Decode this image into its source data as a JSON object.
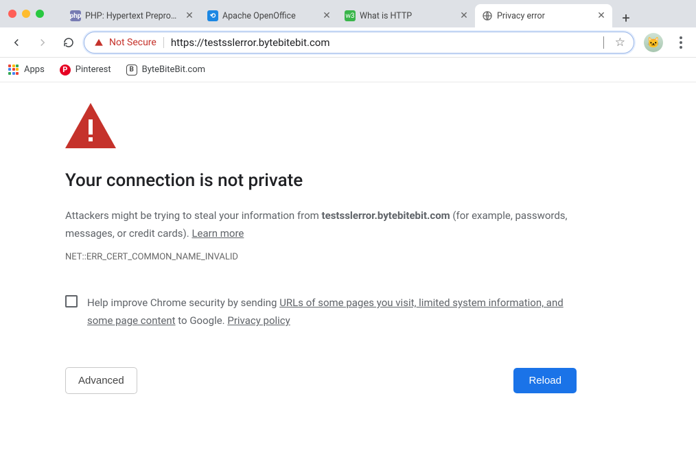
{
  "tabs": [
    {
      "title": "PHP: Hypertext Preprocessor",
      "active": false,
      "favicon": "php"
    },
    {
      "title": "Apache OpenOffice",
      "active": false,
      "favicon": "ooo"
    },
    {
      "title": "What is HTTP",
      "active": false,
      "favicon": "http"
    },
    {
      "title": "Privacy error",
      "active": true,
      "favicon": "globe"
    }
  ],
  "toolbar": {
    "not_secure_label": "Not Secure",
    "url": "https://testsslerror.bytebitebit.com"
  },
  "bookmarks": {
    "apps_label": "Apps",
    "items": [
      {
        "label": "Pinterest",
        "icon": "pinterest"
      },
      {
        "label": "ByteBiteBit.com",
        "icon": "bbb"
      }
    ]
  },
  "page": {
    "heading": "Your connection is not private",
    "para_prefix": "Attackers might be trying to steal your information from ",
    "para_domain": "testsslerror.bytebitebit.com",
    "para_suffix": " (for example, passwords, messages, or credit cards). ",
    "learn_more": "Learn more",
    "error_code": "NET::ERR_CERT_COMMON_NAME_INVALID",
    "optin_prefix": "Help improve Chrome security by sending ",
    "optin_link1": "URLs of some pages you visit, limited system information, and some page content",
    "optin_middle": " to Google. ",
    "optin_link2": "Privacy policy",
    "advanced_label": "Advanced",
    "reload_label": "Reload"
  },
  "colors": {
    "danger": "#c5322b",
    "primary": "#1a73e8"
  }
}
